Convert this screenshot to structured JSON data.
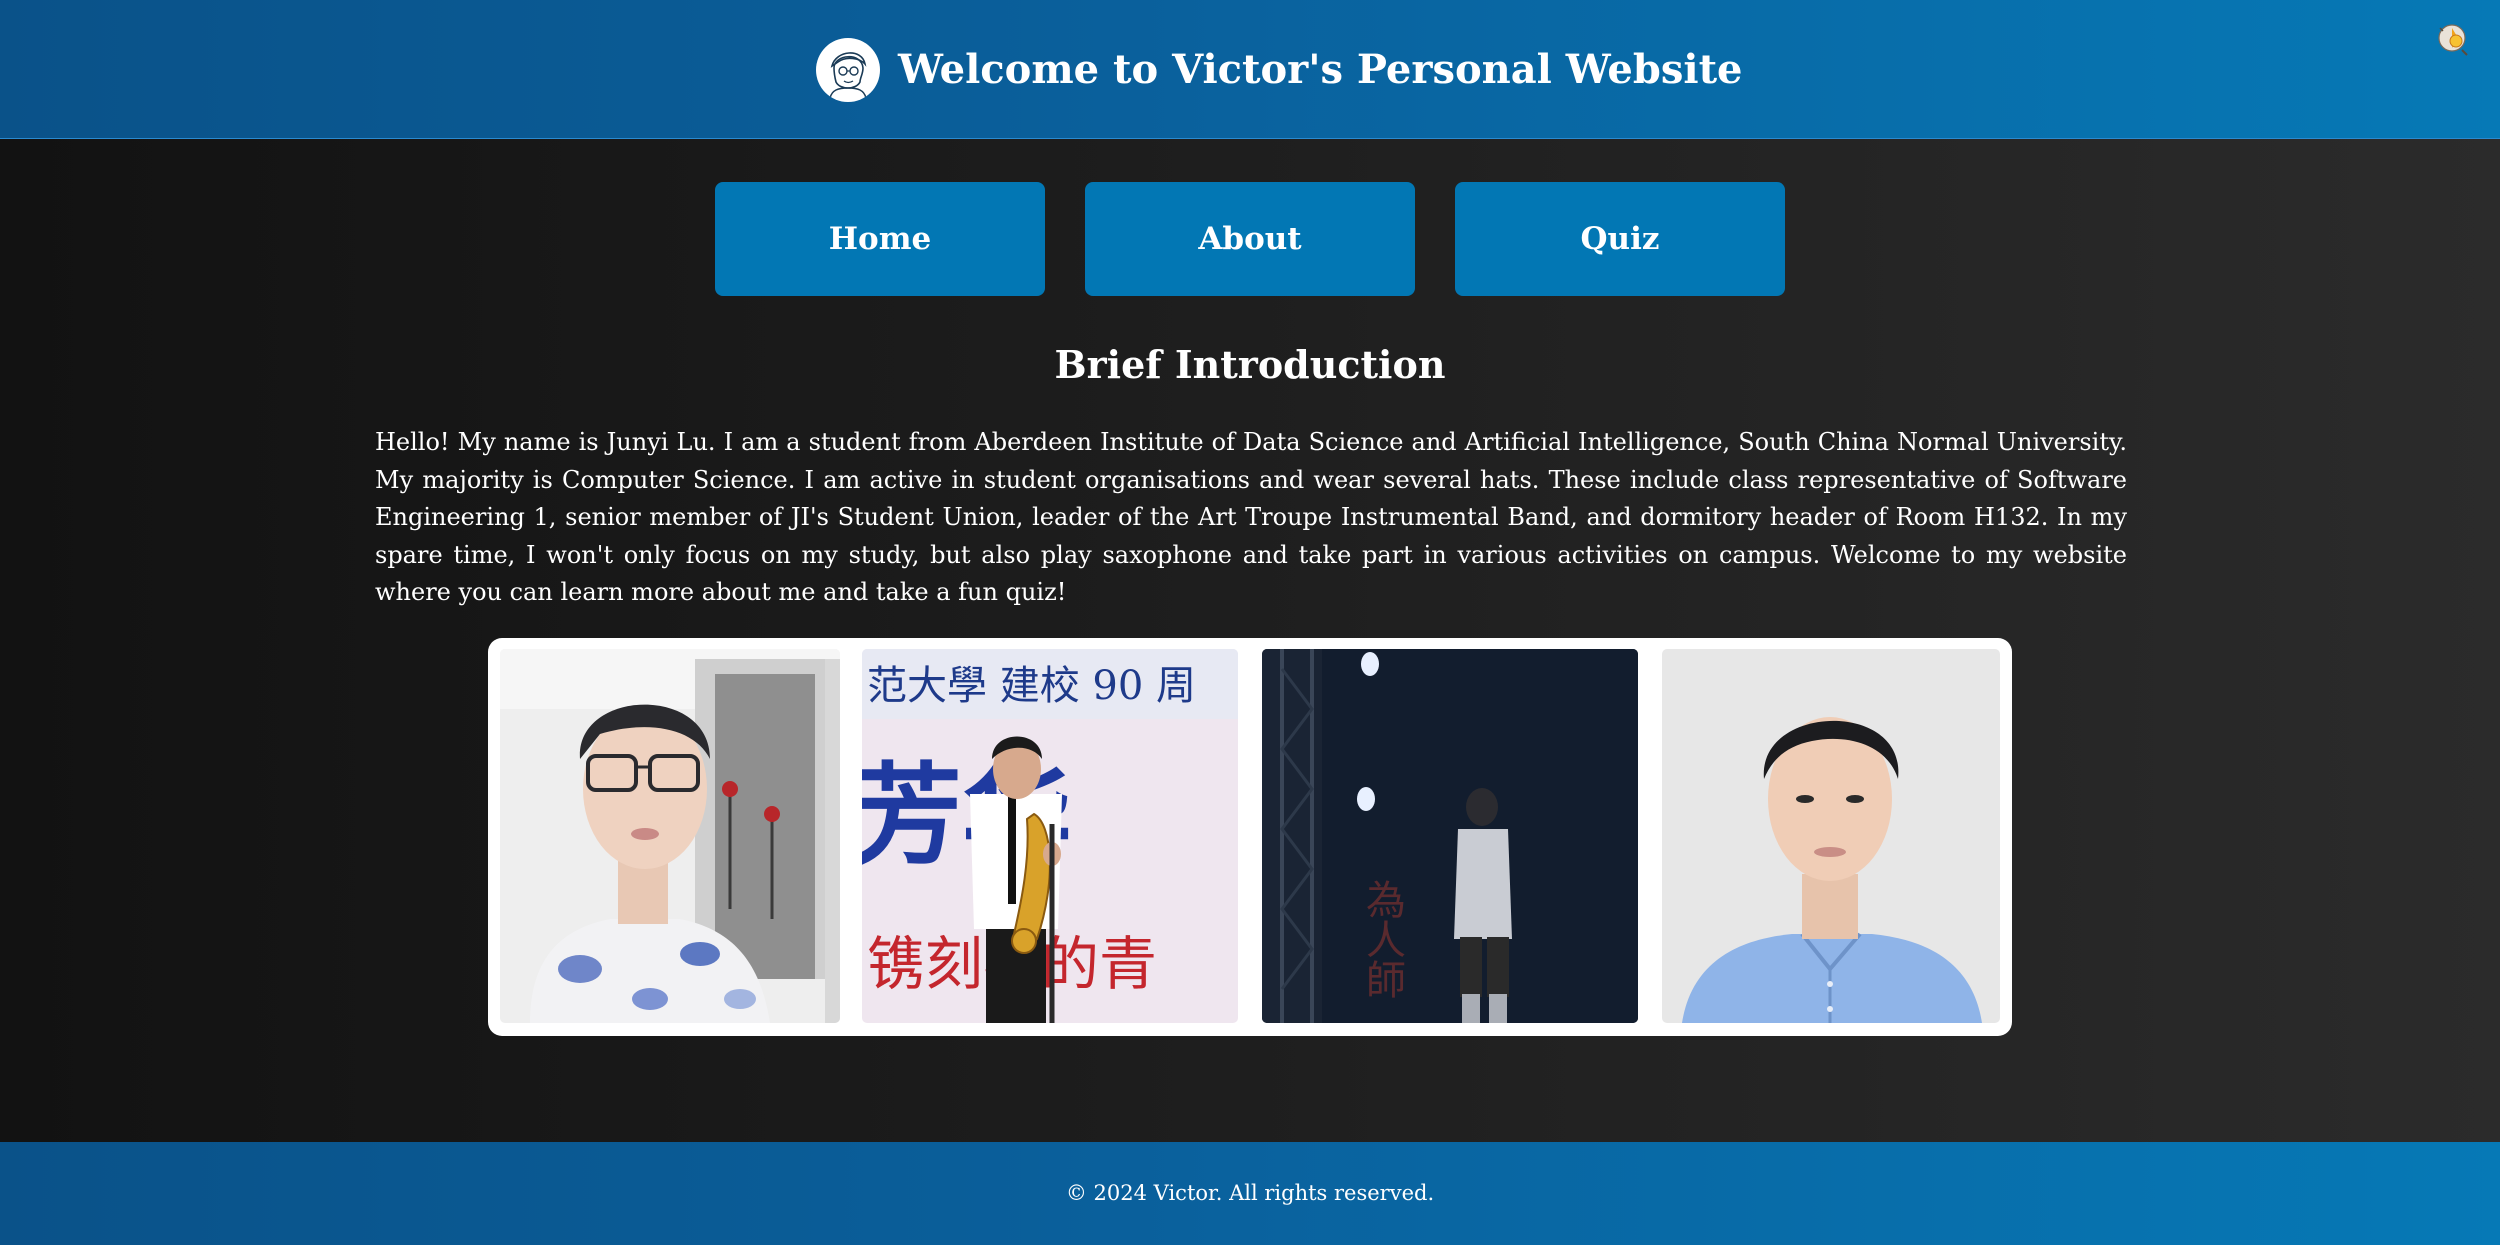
{
  "header": {
    "title": "Welcome to Victor's Personal Website",
    "logo_icon": "sketch-portrait-avatar-icon",
    "theme_toggle_icon": "lightbulb-toggle-icon"
  },
  "nav": {
    "items": [
      {
        "label": "Home"
      },
      {
        "label": "About"
      },
      {
        "label": "Quiz"
      }
    ]
  },
  "intro": {
    "heading": "Brief Introduction",
    "text": "Hello! My name is Junyi Lu. I am a student from Aberdeen Institute of Data Science and Artificial Intelligence, South China Normal University. My majority is Computer Science. I am active in student organisations and wear several hats. These include class representative of Software Engineering 1, senior member of JI's Student Union, leader of the Art Troupe Instrumental Band, and dormitory header of Room H132. In my spare time, I won't only focus on my study, but also play saxophone and take part in various activities on campus. Welcome to my website where you can learn more about me and take a fun quiz!"
  },
  "gallery": {
    "photos": [
      {
        "name": "selfie-photo"
      },
      {
        "name": "saxophone-performance-photo",
        "banner_top": "范大學 建校 90 周",
        "banner_big": "芳华",
        "banner_bottom": "镌刻我的青"
      },
      {
        "name": "stage-dark-photo",
        "banner_chars": "為人師"
      },
      {
        "name": "portrait-photo"
      }
    ]
  },
  "colors": {
    "header_blue": "#0a609c",
    "button_blue": "#0277b4",
    "background_dark": "#1d1d1d",
    "text": "#ffffff"
  },
  "footer": {
    "text": "© 2024 Victor. All rights reserved."
  }
}
